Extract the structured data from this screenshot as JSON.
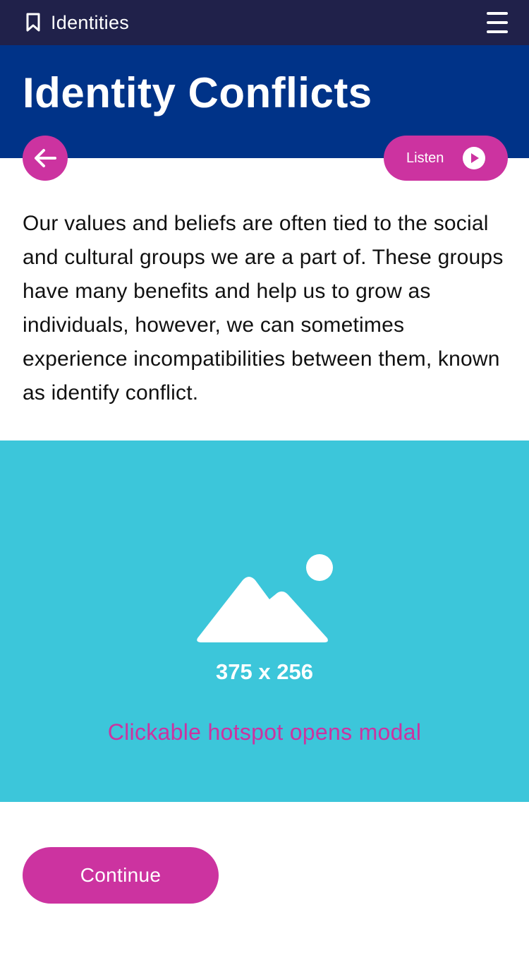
{
  "header": {
    "app_title": "Identities",
    "bookmark_icon": "bookmark-icon",
    "menu_icon": "hamburger-menu-icon"
  },
  "hero": {
    "title": "Identity Conflicts",
    "background": "#003388"
  },
  "controls": {
    "back_icon": "arrow-left-icon",
    "listen_label": "Listen",
    "listen_icon": "play-icon",
    "accent": "#cc33a0"
  },
  "content": {
    "intro": "Our values and beliefs are often tied to the social and cultural groups we are a part of. These groups have many benefits and help us to grow as individuals, however, we can sometimes experience incompatibilities between them, known as identify conflict."
  },
  "hotspot": {
    "icon": "image-placeholder-icon",
    "dimensions": "375 x 256",
    "caption": "Clickable hotspot opens modal",
    "background": "#3cc6da"
  },
  "footer": {
    "continue_label": "Continue"
  }
}
